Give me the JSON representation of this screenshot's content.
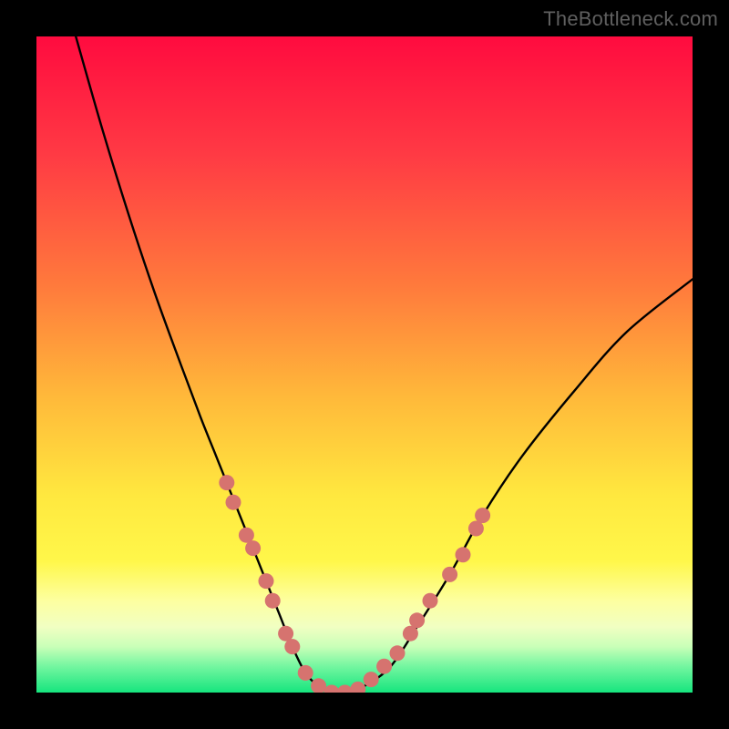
{
  "watermark": "TheBottleneck.com",
  "chart_data": {
    "type": "line",
    "title": "",
    "xlabel": "",
    "ylabel": "",
    "xlim": [
      0,
      100
    ],
    "ylim": [
      0,
      100
    ],
    "series": [
      {
        "name": "bottleneck-curve",
        "x": [
          6,
          10,
          14,
          18,
          22,
          25,
          27,
          29,
          31,
          33,
          35,
          37,
          39,
          41,
          43,
          45,
          47,
          50,
          54,
          58,
          63,
          68,
          74,
          82,
          90,
          100
        ],
        "y": [
          100,
          86,
          73,
          61,
          50,
          42,
          37,
          32,
          27,
          22,
          17,
          12,
          7,
          3,
          1,
          0,
          0,
          1,
          4,
          10,
          18,
          27,
          36,
          46,
          55,
          63
        ]
      }
    ],
    "markers": {
      "name": "highlight-dots",
      "color": "#d6736f",
      "points": [
        {
          "x": 29,
          "y": 32
        },
        {
          "x": 30,
          "y": 29
        },
        {
          "x": 32,
          "y": 24
        },
        {
          "x": 33,
          "y": 22
        },
        {
          "x": 35,
          "y": 17
        },
        {
          "x": 36,
          "y": 14
        },
        {
          "x": 38,
          "y": 9
        },
        {
          "x": 39,
          "y": 7
        },
        {
          "x": 41,
          "y": 3
        },
        {
          "x": 43,
          "y": 1
        },
        {
          "x": 45,
          "y": 0
        },
        {
          "x": 47,
          "y": 0
        },
        {
          "x": 49,
          "y": 0.5
        },
        {
          "x": 51,
          "y": 2
        },
        {
          "x": 53,
          "y": 4
        },
        {
          "x": 55,
          "y": 6
        },
        {
          "x": 57,
          "y": 9
        },
        {
          "x": 58,
          "y": 11
        },
        {
          "x": 60,
          "y": 14
        },
        {
          "x": 63,
          "y": 18
        },
        {
          "x": 65,
          "y": 21
        },
        {
          "x": 67,
          "y": 25
        },
        {
          "x": 68,
          "y": 27
        }
      ]
    },
    "gradient_stops": [
      {
        "offset": 0,
        "color": "#ff0b3f"
      },
      {
        "offset": 0.18,
        "color": "#ff3a44"
      },
      {
        "offset": 0.38,
        "color": "#ff7a3c"
      },
      {
        "offset": 0.55,
        "color": "#ffb93a"
      },
      {
        "offset": 0.7,
        "color": "#ffe83f"
      },
      {
        "offset": 0.8,
        "color": "#fff74a"
      },
      {
        "offset": 0.86,
        "color": "#fdffa0"
      },
      {
        "offset": 0.9,
        "color": "#f1ffc2"
      },
      {
        "offset": 0.93,
        "color": "#c9ffb8"
      },
      {
        "offset": 0.96,
        "color": "#74f6a0"
      },
      {
        "offset": 1.0,
        "color": "#16e57e"
      }
    ]
  }
}
